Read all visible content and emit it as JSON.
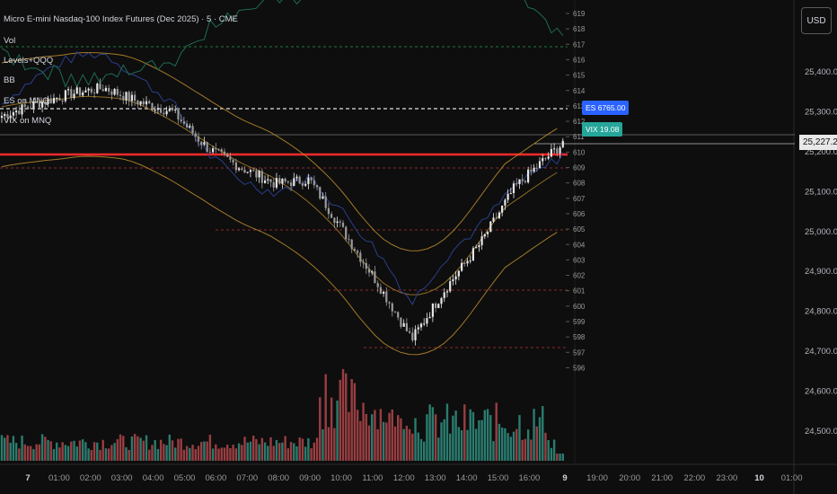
{
  "header": {
    "title": "Micro E-mini Nasdaq-100 Index Futures (Dec 2025) · 5 · CME",
    "currency_button": "USD"
  },
  "legend": [
    "Vol",
    "Levels+QQQ",
    "BB",
    "ES on MNQ",
    "VIX on MNQ"
  ],
  "tags": {
    "es": "ES 6765.00",
    "vix": "VIX 19.08",
    "last_price": "25,227.25"
  },
  "colors": {
    "background": "#0e0e0e",
    "up_candle": "#e6e6e6",
    "down_candle": "#9a9a9a",
    "volume_up": "#2f8f7f",
    "volume_down": "#b2474b",
    "bb": "#b4862a",
    "es_line": "#2a3f8c",
    "vix_line": "#1f6b56",
    "resistance": "#ff2a2a",
    "es_tag": "#2962ff",
    "vix_tag": "#26a69a"
  },
  "chart_data": {
    "type": "candlestick",
    "right_axis": {
      "labels": [
        "25,400.00",
        "25,300.00",
        "25,200.00",
        "25,100.00",
        "25,000.00",
        "24,900.00",
        "24,800.00",
        "24,700.00",
        "24,600.00",
        "24,500.00"
      ],
      "range": [
        24450,
        25530
      ]
    },
    "inner_axis": {
      "labels": [
        "619",
        "618",
        "617",
        "616",
        "615",
        "614",
        "613",
        "612",
        "611",
        "610",
        "609",
        "608",
        "607",
        "606",
        "605",
        "604",
        "603",
        "602",
        "601",
        "600",
        "599",
        "598",
        "597",
        "596"
      ],
      "range_note": "QQQ scale"
    },
    "x_axis": {
      "labels": [
        "7",
        "01:00",
        "02:00",
        "03:00",
        "04:00",
        "05:00",
        "06:00",
        "07:00",
        "08:00",
        "09:00",
        "10:00",
        "11:00",
        "12:00",
        "13:00",
        "14:00",
        "15:00",
        "16:00",
        "9",
        "19:00",
        "20:00",
        "21:00",
        "22:00",
        "23:00",
        "10",
        "01:00"
      ]
    },
    "price_path": [
      [
        0,
        25290
      ],
      [
        1,
        25320
      ],
      [
        2,
        25345
      ],
      [
        3,
        25360
      ],
      [
        4,
        25325
      ],
      [
        5,
        25300
      ],
      [
        6,
        25210
      ],
      [
        7,
        25160
      ],
      [
        8,
        25120
      ],
      [
        9,
        25130
      ],
      [
        10,
        25000
      ],
      [
        11,
        24870
      ],
      [
        12,
        24730
      ],
      [
        13,
        24860
      ],
      [
        14,
        24970
      ],
      [
        15,
        25110
      ],
      [
        16,
        25190
      ],
      [
        16.5,
        25227
      ]
    ],
    "last_price": 25227.25,
    "horizontal_levels": {
      "red_solid": 25200,
      "white_dashed": 25315,
      "green_dashed_qqq": 617
    }
  }
}
